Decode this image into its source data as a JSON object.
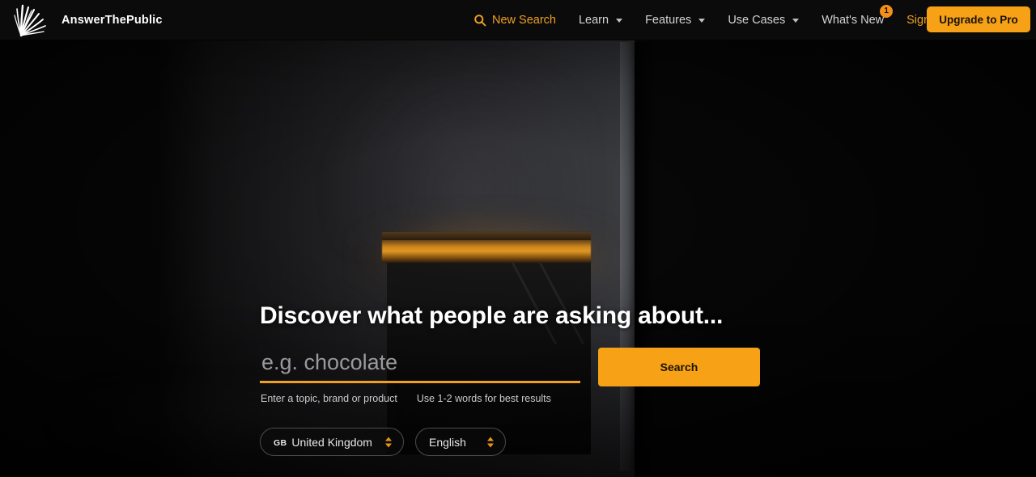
{
  "brand": {
    "name": "AnswerThePublic",
    "logo_icon": "fan-burst-logo-icon"
  },
  "header": {
    "nav": [
      {
        "label": "New Search",
        "icon": "search-icon",
        "accent": true,
        "has_caret": false,
        "badge": null
      },
      {
        "label": "Learn",
        "icon": null,
        "accent": false,
        "has_caret": true,
        "badge": null
      },
      {
        "label": "Features",
        "icon": null,
        "accent": false,
        "has_caret": true,
        "badge": null
      },
      {
        "label": "Use Cases",
        "icon": null,
        "accent": false,
        "has_caret": true,
        "badge": null
      },
      {
        "label": "What's New",
        "icon": null,
        "accent": false,
        "has_caret": false,
        "badge": "1"
      }
    ],
    "sign_in_label": "Sign in",
    "upgrade_label": "Upgrade to Pro"
  },
  "hero": {
    "headline": "Discover what people are asking about...",
    "search": {
      "placeholder": "e.g. chocolate",
      "value": "",
      "button_label": "Search"
    },
    "hints": [
      "Enter a topic, brand or product",
      "Use 1-2 words for best results"
    ],
    "country_select": {
      "country_code": "GB",
      "value": "United Kingdom",
      "stepper_icon": "up-down-stepper-icon"
    },
    "language_select": {
      "value": "English",
      "stepper_icon": "up-down-stepper-icon"
    }
  },
  "colors": {
    "accent": "#f7a117",
    "accent_text": "#f0a020",
    "header_bg": "#0b0b0c",
    "page_bg": "#070707",
    "nav_text": "#d3d4d6",
    "badge_bg": "#f2901b"
  }
}
